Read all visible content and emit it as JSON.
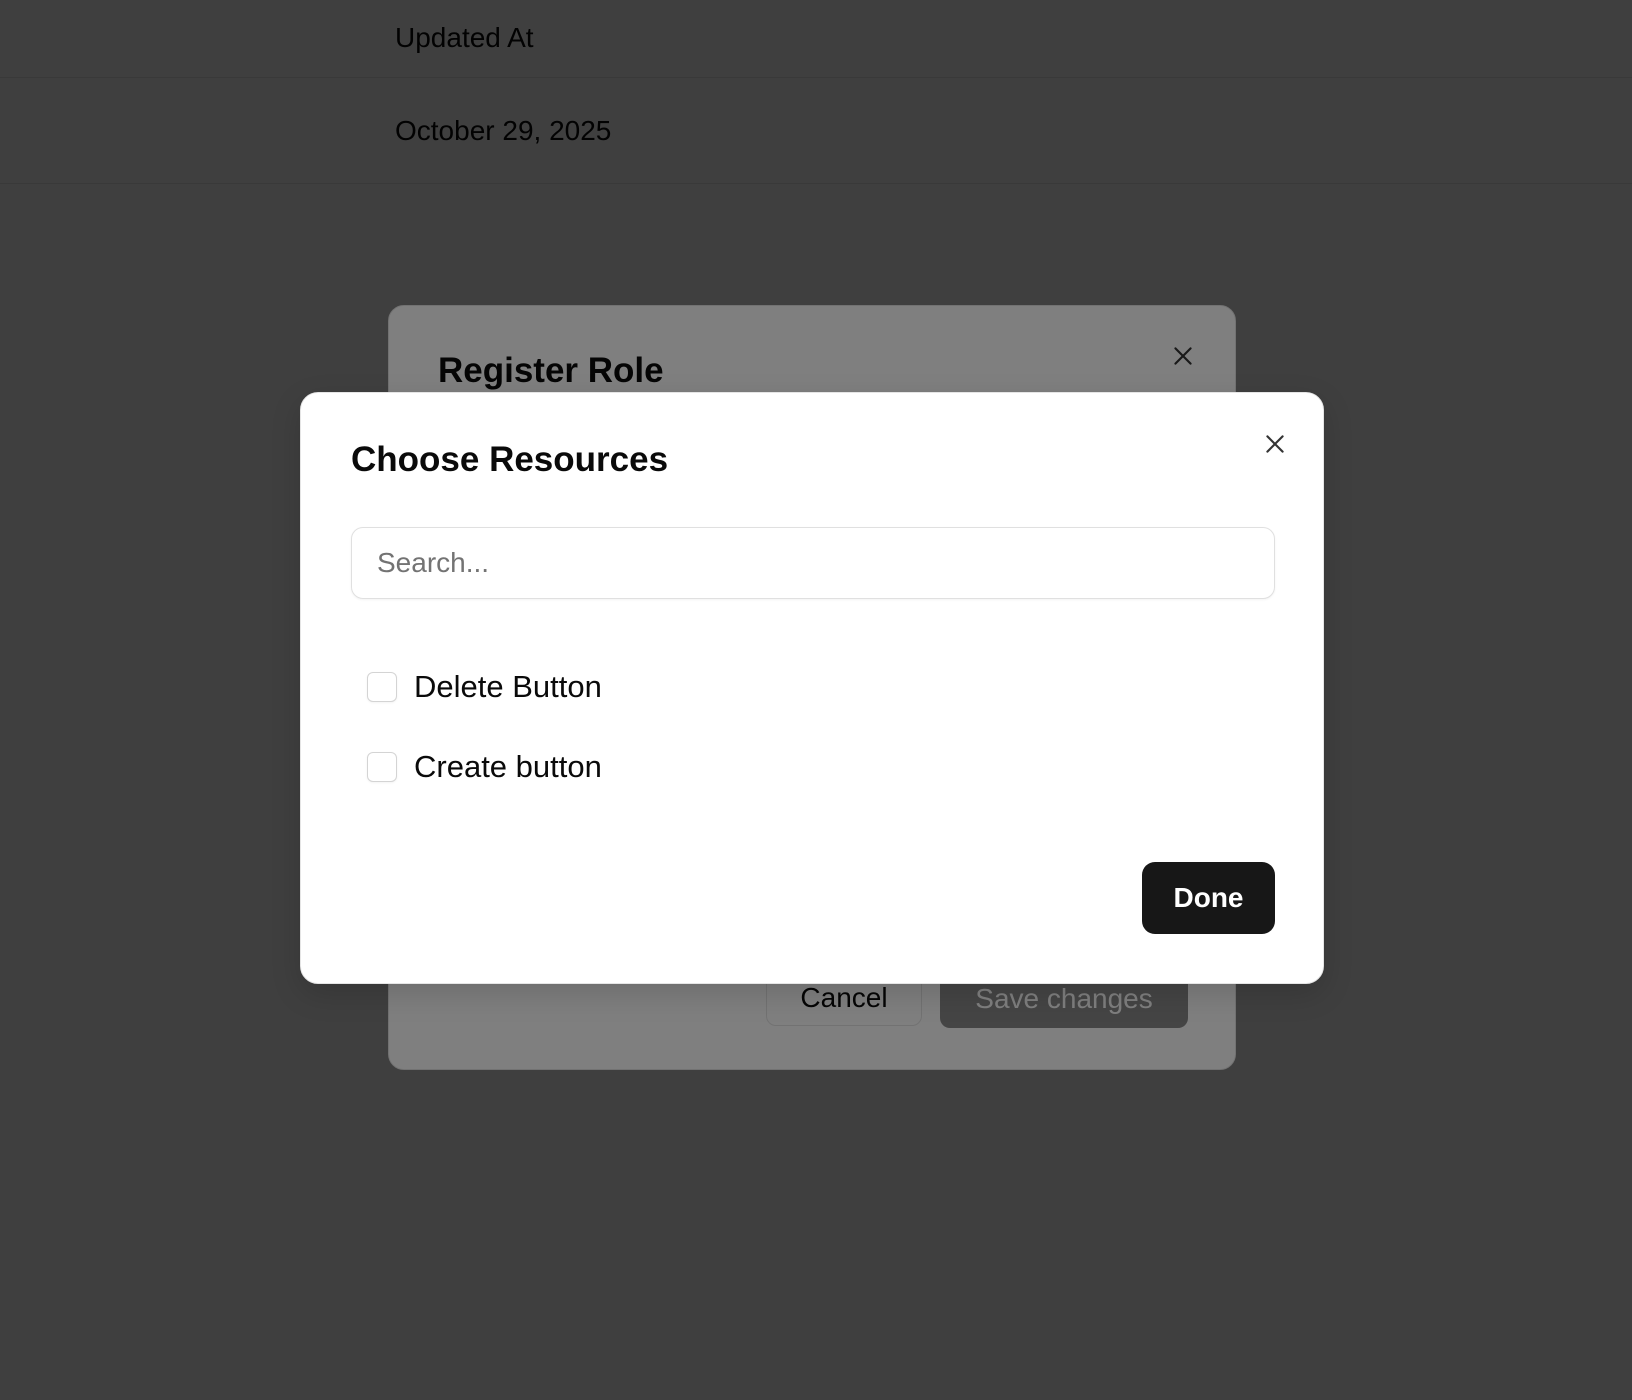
{
  "background": {
    "table_header": "Updated At",
    "table_cell": "October 29, 2025"
  },
  "register_dialog": {
    "title": "Register Role",
    "close_icon": "close-icon",
    "cancel_label": "Cancel",
    "save_label": "Save changes"
  },
  "choose_dialog": {
    "title": "Choose Resources",
    "close_icon": "close-icon",
    "search": {
      "placeholder": "Search...",
      "value": ""
    },
    "items": [
      {
        "label": "Delete Button",
        "checked": false
      },
      {
        "label": "Create button",
        "checked": false
      }
    ],
    "done_label": "Done"
  },
  "colors": {
    "primary_button": "#171717",
    "overlay": "rgba(0,0,0,0.5)",
    "border": "#e5e5e5"
  }
}
